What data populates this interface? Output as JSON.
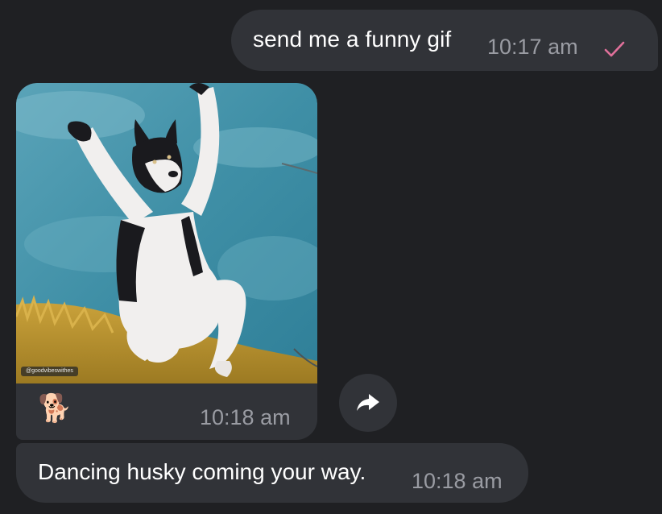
{
  "messages": [
    {
      "direction": "outgoing",
      "text": "send me a funny gif",
      "time": "10:17 am",
      "status_icon": "check-icon",
      "status_color": "#e0709a"
    },
    {
      "direction": "incoming",
      "type": "gif",
      "watermark": "@goodvibeswithes",
      "caption_emoji": "🐕",
      "time": "10:18 am"
    },
    {
      "direction": "incoming",
      "type": "text",
      "text": "Dancing husky coming your way.",
      "time": "10:18 am"
    }
  ],
  "actions": {
    "forward_icon": "forward-arrow-icon"
  },
  "colors": {
    "background": "#1f2023",
    "bubble": "#313338",
    "timestamp": "#9a9ca3",
    "accent": "#e0709a"
  }
}
